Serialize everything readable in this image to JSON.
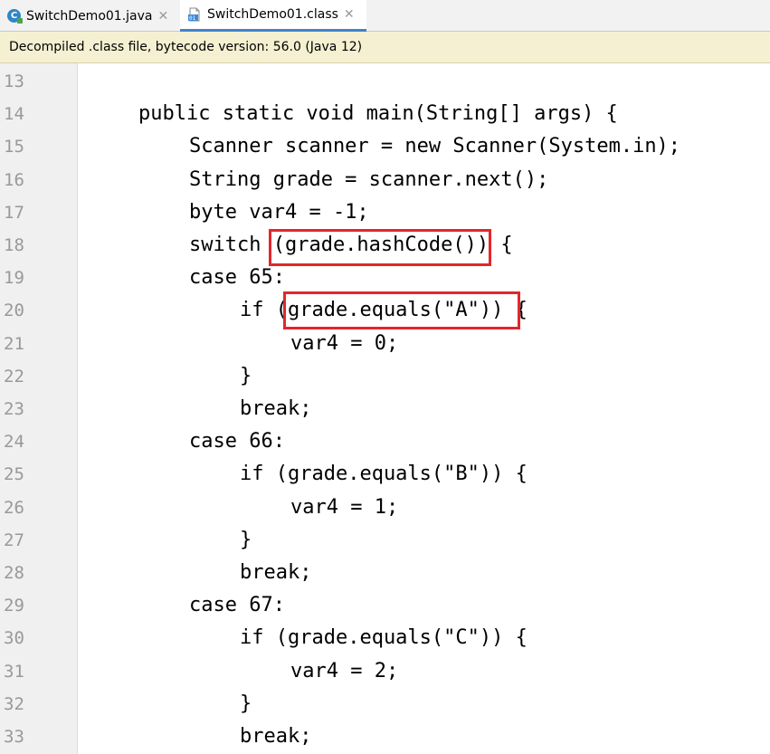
{
  "tabs": [
    {
      "label": "SwitchDemo01.java",
      "icon": "java-class-icon",
      "active": false
    },
    {
      "label": "SwitchDemo01.class",
      "icon": "class-file-icon",
      "active": true
    }
  ],
  "banner": {
    "text": "Decompiled .class file, bytecode version: 56.0 (Java 12)"
  },
  "editor": {
    "lines": [
      {
        "num": "13",
        "indent": 0,
        "text": ""
      },
      {
        "num": "14",
        "indent": 1,
        "text": "public static void main(String[] args) {"
      },
      {
        "num": "15",
        "indent": 2,
        "text": "Scanner scanner = new Scanner(System.in);"
      },
      {
        "num": "16",
        "indent": 2,
        "text": "String grade = scanner.next();"
      },
      {
        "num": "17",
        "indent": 2,
        "text": "byte var4 = -1;"
      },
      {
        "num": "18",
        "indent": 2,
        "text": "switch (grade.hashCode()) {"
      },
      {
        "num": "19",
        "indent": 2,
        "text": "case 65:"
      },
      {
        "num": "20",
        "indent": 3,
        "text": "if (grade.equals(\"A\")) {"
      },
      {
        "num": "21",
        "indent": 4,
        "text": "var4 = 0;"
      },
      {
        "num": "22",
        "indent": 3,
        "text": "}"
      },
      {
        "num": "23",
        "indent": 3,
        "text": "break;"
      },
      {
        "num": "24",
        "indent": 2,
        "text": "case 66:"
      },
      {
        "num": "25",
        "indent": 3,
        "text": "if (grade.equals(\"B\")) {"
      },
      {
        "num": "26",
        "indent": 4,
        "text": "var4 = 1;"
      },
      {
        "num": "27",
        "indent": 3,
        "text": "}"
      },
      {
        "num": "28",
        "indent": 3,
        "text": "break;"
      },
      {
        "num": "29",
        "indent": 2,
        "text": "case 67:"
      },
      {
        "num": "30",
        "indent": 3,
        "text": "if (grade.equals(\"C\")) {"
      },
      {
        "num": "31",
        "indent": 4,
        "text": "var4 = 2;"
      },
      {
        "num": "32",
        "indent": 3,
        "text": "}"
      },
      {
        "num": "33",
        "indent": 3,
        "text": "break;"
      }
    ],
    "highlight_color": "#e3262c"
  }
}
